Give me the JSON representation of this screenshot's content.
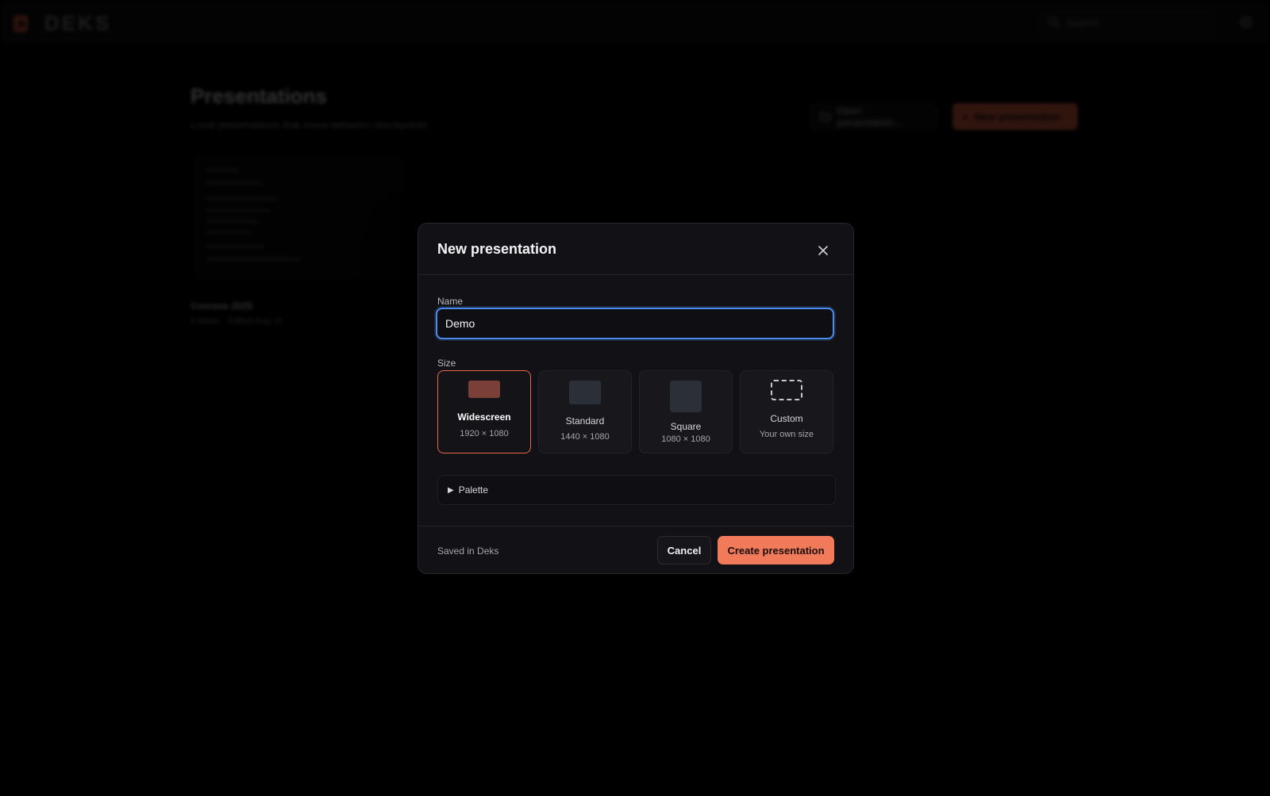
{
  "app": {
    "brand": "DEKS",
    "search_placeholder": "Search"
  },
  "page": {
    "title": "Presentations",
    "subtitle": "Local presentations that move between checkpoints",
    "open_button": "Open presentation…",
    "new_button": "New presentation",
    "card": {
      "title": "Coresoe 2025",
      "meta": "9 slides · Edited Aug 10"
    }
  },
  "modal": {
    "title": "New presentation",
    "name_label": "Name",
    "name_value": "Demo",
    "size_label": "Size",
    "sizes": [
      {
        "name": "Widescreen",
        "dim": "1920 × 1080",
        "selected": true
      },
      {
        "name": "Standard",
        "dim": "1440 × 1080",
        "selected": false
      },
      {
        "name": "Square",
        "dim": "1080 × 1080",
        "selected": false
      },
      {
        "name": "Custom",
        "dim": "Your own size",
        "selected": false
      }
    ],
    "palette_label": "Palette",
    "footer_note": "Saved in Deks",
    "cancel_label": "Cancel",
    "create_label": "Create presentation"
  },
  "colors": {
    "accent": "#f07a5a",
    "focus": "#4a8bf0",
    "widescreen_swatch": "#7a3f36",
    "shape_fill": "#2a2f38"
  }
}
